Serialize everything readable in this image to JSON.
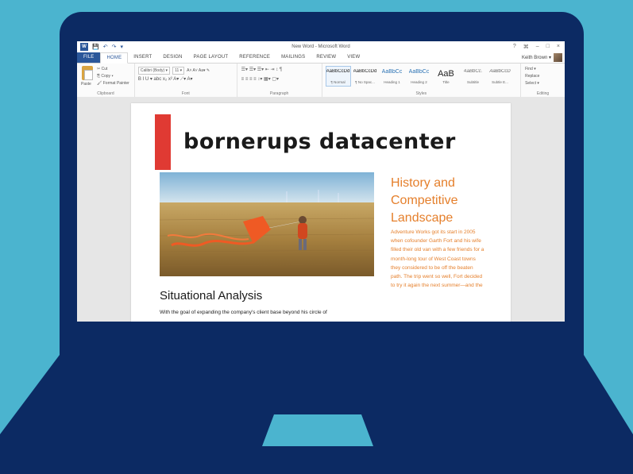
{
  "window": {
    "title": "New Word - Microsoft Word",
    "app_icon_letter": "W",
    "controls": [
      "?",
      "⌘",
      "–",
      "□",
      "×"
    ]
  },
  "quick_access": [
    "💾",
    "↶",
    "↷",
    "▾"
  ],
  "tabs": [
    {
      "label": "FILE"
    },
    {
      "label": "HOME"
    },
    {
      "label": "INSERT"
    },
    {
      "label": "DESIGN"
    },
    {
      "label": "PAGE LAYOUT"
    },
    {
      "label": "REFERENCE"
    },
    {
      "label": "MAILINGS"
    },
    {
      "label": "REVIEW"
    },
    {
      "label": "VIEW"
    }
  ],
  "user": {
    "name": "Keith Brown ▾"
  },
  "ribbon": {
    "clipboard": {
      "label": "Clipboard",
      "paste": "Paste",
      "cut": "✂ Cut",
      "copy": "⎘ Copy ▾",
      "format_painter": "🖌 Format Painter"
    },
    "font": {
      "label": "Font",
      "font_name": "Calibri (Body) ▾",
      "font_size": "11 ▾",
      "row1_tools": "A˄ A˅  Aa▾  ✎",
      "row2_tools": "B  I  U ▾ abc x₂ x²  A▾  ⟋▾  A▾"
    },
    "paragraph": {
      "label": "Paragraph",
      "row1": "☰▾ ☰▾ ☰▾  ⇤ ⇥  ↕ ¶",
      "row2": "≡ ≡ ≡ ≡  ↕▾  ▦▾  ▢▾"
    },
    "styles": {
      "label": "Styles",
      "items": [
        {
          "sample": "AaBbCcDd",
          "name": "¶ Normal"
        },
        {
          "sample": "AaBbCcDd",
          "name": "¶ No Spac..."
        },
        {
          "sample": "AaBbCc",
          "name": "Heading 1"
        },
        {
          "sample": "AaBbCc",
          "name": "Heading 2"
        },
        {
          "sample": "AaB",
          "name": "Title"
        },
        {
          "sample": "AaBbCc.",
          "name": "Subtitle"
        },
        {
          "sample": "AaBbCcD",
          "name": "Subtle E..."
        }
      ]
    },
    "editing": {
      "label": "Editing",
      "find": "Find ▾",
      "replace": "Replace",
      "select": "Select ▾"
    }
  },
  "document": {
    "title": "bornerups datacenter",
    "section_title": "Situational Analysis",
    "section_body": "With the goal of expanding the company's client base beyond his circle of",
    "sidebar_title": "History and Competitive Landscape",
    "sidebar_body": "Adventure Works got its start in 2005 when cofounder Garth Fort and his wife filled their old van with a few friends for a month-long tour of West Coast towns they considered to be off the beaten path. The trip went so well, Fort decided to try it again the next summer—and the"
  },
  "colors": {
    "background": "#4bb4cf",
    "laptop": "#0c2a63",
    "accent_red": "#e03a33",
    "accent_orange": "#e57f2b",
    "word_blue": "#2b579a"
  }
}
